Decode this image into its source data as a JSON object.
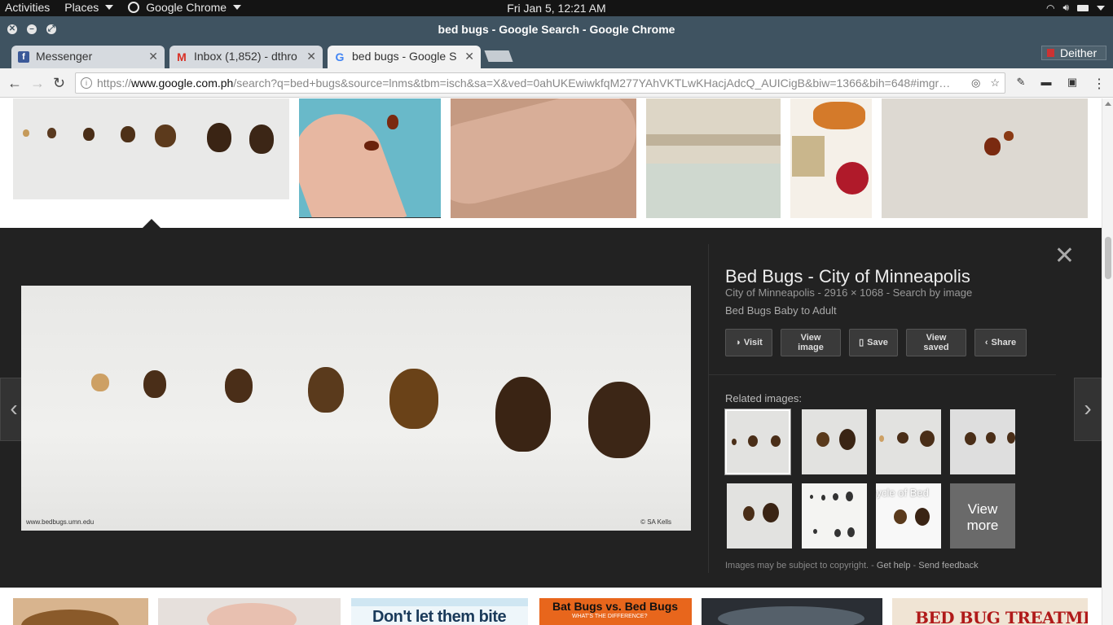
{
  "topbar": {
    "activities": "Activities",
    "places": "Places",
    "app": "Google Chrome",
    "clock": "Fri Jan  5, 12:21 AM"
  },
  "window": {
    "title": "bed bugs - Google Search - Google Chrome"
  },
  "tabs": [
    {
      "label": "Messenger",
      "favicon": "facebook-icon",
      "color": "#3b5998"
    },
    {
      "label": "Inbox (1,852) - dthro",
      "favicon": "gmail-icon",
      "color": "#d93025"
    },
    {
      "label": "bed bugs - Google S",
      "favicon": "google-icon",
      "color": "#4285f4"
    }
  ],
  "profile": {
    "name": "Deither"
  },
  "address": {
    "scheme": "https://",
    "host": "www.google.com.ph",
    "path": "/search?q=bed+bugs&source=lnms&tbm=isch&sa=X&ved=0ahUKEwiwkfqM277YAhVKTLwKHacjAdcQ_AUICigB&biw=1366&bih=648#imgr…"
  },
  "preview": {
    "title": "Bed Bugs - City of Minneapolis",
    "source": "City of Minneapolis",
    "dims": "2916 × 1068",
    "search_by_image": "Search by image",
    "description": "Bed Bugs Baby to Adult",
    "watermark_left": "www.bedbugs.umn.edu",
    "watermark_right": "© SA Kells",
    "buttons": {
      "visit": "Visit",
      "view_image": "View image",
      "save": "Save",
      "view_saved": "View saved",
      "share": "Share"
    },
    "related_label": "Related images:",
    "related_overlay_text": "cycle of Bed",
    "view_more": "View more",
    "footer": {
      "copyright": "Images may be subject to copyright.",
      "help": "Get help",
      "feedback": "Send feedback"
    }
  },
  "bottom_thumbs": {
    "dont_let": "Don't let them bite",
    "bat_bugs": "Bat Bugs vs. Bed Bugs",
    "bat_sub": "WHAT'S THE DIFFERENCE?",
    "treatment": "BED BUG TREATMENT"
  },
  "colors": {
    "panel_bg": "#222222",
    "chrome_frame": "#3f5361",
    "accent_orange": "#e8661c"
  }
}
